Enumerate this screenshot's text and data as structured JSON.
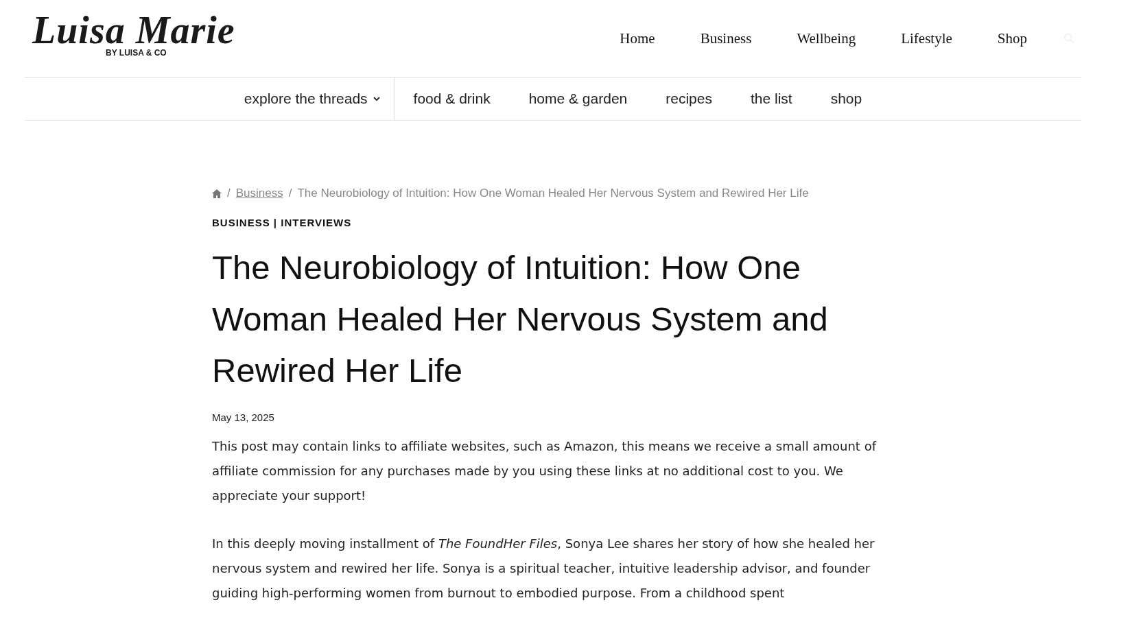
{
  "header": {
    "logo": {
      "title": "Luisa Marie",
      "subtitle": "BY LUISA & CO"
    },
    "nav": [
      {
        "label": "Home"
      },
      {
        "label": "Business"
      },
      {
        "label": "Wellbeing"
      },
      {
        "label": "Lifestyle"
      },
      {
        "label": "Shop"
      }
    ]
  },
  "subnav": [
    {
      "label": "explore the threads",
      "dropdown": true
    },
    {
      "label": "food & drink",
      "dropdown": false
    },
    {
      "label": "home & garden",
      "dropdown": false
    },
    {
      "label": "recipes",
      "dropdown": false
    },
    {
      "label": "the list",
      "dropdown": false
    },
    {
      "label": "shop",
      "dropdown": false
    }
  ],
  "article": {
    "breadcrumb": {
      "separators": [
        "/",
        "/"
      ],
      "link": "Business",
      "current": "The Neurobiology of Intuition: How One Woman Healed Her Nervous System and Rewired Her Life"
    },
    "categories": "BUSINESS | INTERVIEWS",
    "title": "The Neurobiology of Intuition: How One Woman Healed Her Nervous System and Rewired Her Life",
    "date": "May 13, 2025",
    "paragraphs": [
      "This post may contain links to affiliate websites, such as Amazon, this means we receive a small amount of affiliate commission for any purchases made by you using these links at no additional cost to you. We appreciate your support!",
      "In this deeply moving installment of *The FoundHer Files*, Sonya Lee shares her story of how she healed her nervous system and rewired her life. Sonya is a spiritual teacher, intuitive leadership advisor, and founder guiding high-performing women from burnout to embodied purpose. From a childhood spent"
    ]
  }
}
